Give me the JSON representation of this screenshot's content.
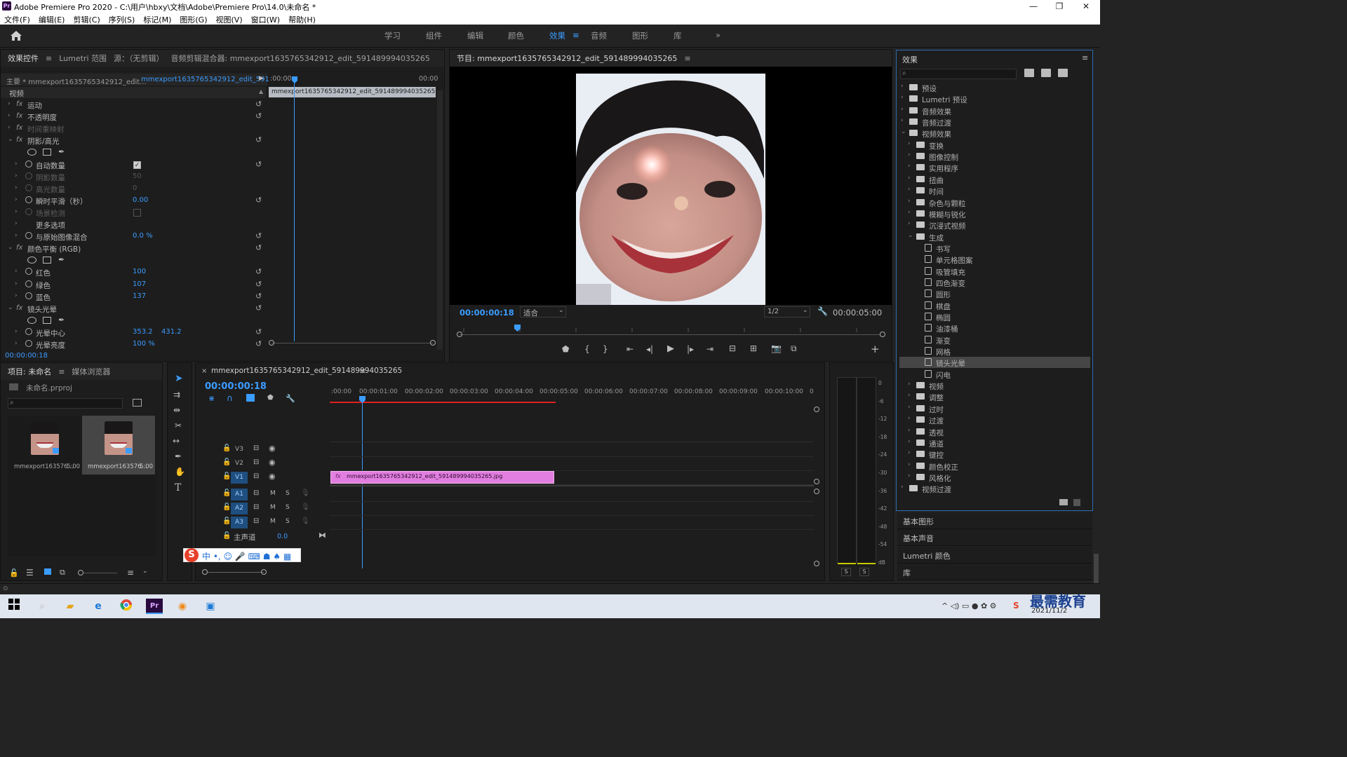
{
  "window": {
    "title": "Adobe Premiere Pro 2020 - C:\\用户\\hbxy\\文档\\Adobe\\Premiere Pro\\14.0\\未命名 *",
    "logo_text": "Pr",
    "minimize": "—",
    "restore": "❐",
    "close": "✕"
  },
  "menu": [
    "文件(F)",
    "编辑(E)",
    "剪辑(C)",
    "序列(S)",
    "标记(M)",
    "图形(G)",
    "视图(V)",
    "窗口(W)",
    "帮助(H)"
  ],
  "workspaces": {
    "items": [
      "学习",
      "组件",
      "编辑",
      "颜色",
      "效果",
      "音频",
      "图形",
      "库"
    ],
    "active": "效果",
    "more": "»"
  },
  "effect_controls": {
    "tabs": [
      "效果控件",
      "Lumetri 范围",
      "源：（无剪辑）",
      "音频剪辑混合器: mmexport1635765342912_edit_591489994035265"
    ],
    "master_label": "主要 * mmexport1635765342912_edit...",
    "clip_label": "mmexport1635765342912_edit_591...",
    "time_start": ":00:00",
    "time_end": "00:00",
    "clip_bar": "mmexport1635765342912_edit_591489994035265.jpg",
    "section_video": "视频",
    "rows": [
      {
        "type": "fx",
        "label": "运动"
      },
      {
        "type": "fx",
        "label": "不透明度"
      },
      {
        "type": "fx-off",
        "label": "时间重映射"
      },
      {
        "type": "fx-open",
        "label": "阴影/高光"
      },
      {
        "type": "masks"
      },
      {
        "type": "param",
        "label": "自动数量",
        "checkbox": true,
        "checked": true
      },
      {
        "type": "param-off",
        "label": "阴影数量",
        "value": "50"
      },
      {
        "type": "param-off",
        "label": "高光数量",
        "value": "0"
      },
      {
        "type": "param",
        "label": "瞬时平滑（秒）",
        "value": "0.00"
      },
      {
        "type": "param-off",
        "label": "场景检测",
        "checkbox": true,
        "checked": false
      },
      {
        "type": "sub",
        "label": "更多选项"
      },
      {
        "type": "param",
        "label": "与原始图像混合",
        "value": "0.0 %"
      },
      {
        "type": "fx-open",
        "label": "颜色平衡 (RGB)"
      },
      {
        "type": "masks"
      },
      {
        "type": "param",
        "label": "红色",
        "value": "100"
      },
      {
        "type": "param",
        "label": "绿色",
        "value": "107"
      },
      {
        "type": "param",
        "label": "蓝色",
        "value": "137"
      },
      {
        "type": "fx-open",
        "label": "镜头光晕"
      },
      {
        "type": "masks"
      },
      {
        "type": "param",
        "label": "光晕中心",
        "value": "353.2",
        "value2": "431.2"
      },
      {
        "type": "param",
        "label": "光晕亮度",
        "value": "100 %"
      }
    ],
    "current_time": "00:00:00:18"
  },
  "program_monitor": {
    "title": "节目: mmexport1635765342912_edit_591489994035265",
    "timecode": "00:00:00:18",
    "fit": "适合",
    "quality": "1/2",
    "duration": "00:00:05:00"
  },
  "effects_panel": {
    "title": "效果",
    "search_placeholder": "",
    "tree": [
      {
        "level": 0,
        "label": "预设",
        "icon": "folder",
        "open": false
      },
      {
        "level": 0,
        "label": "Lumetri 预设",
        "icon": "folder",
        "open": false
      },
      {
        "level": 0,
        "label": "音频效果",
        "icon": "folder",
        "open": false
      },
      {
        "level": 0,
        "label": "音频过渡",
        "icon": "folder",
        "open": false
      },
      {
        "level": 0,
        "label": "视频效果",
        "icon": "folder",
        "open": true
      },
      {
        "level": 1,
        "label": "变换",
        "icon": "folder",
        "open": false
      },
      {
        "level": 1,
        "label": "图像控制",
        "icon": "folder",
        "open": false
      },
      {
        "level": 1,
        "label": "实用程序",
        "icon": "folder",
        "open": false
      },
      {
        "level": 1,
        "label": "扭曲",
        "icon": "folder",
        "open": false
      },
      {
        "level": 1,
        "label": "时间",
        "icon": "folder",
        "open": false
      },
      {
        "level": 1,
        "label": "杂色与颗粒",
        "icon": "folder",
        "open": false
      },
      {
        "level": 1,
        "label": "模糊与锐化",
        "icon": "folder",
        "open": false
      },
      {
        "level": 1,
        "label": "沉浸式视频",
        "icon": "folder",
        "open": false
      },
      {
        "level": 1,
        "label": "生成",
        "icon": "folder",
        "open": true
      },
      {
        "level": 2,
        "label": "书写",
        "icon": "fx"
      },
      {
        "level": 2,
        "label": "单元格图案",
        "icon": "fx"
      },
      {
        "level": 2,
        "label": "吸管填充",
        "icon": "fx"
      },
      {
        "level": 2,
        "label": "四色渐变",
        "icon": "fx"
      },
      {
        "level": 2,
        "label": "圆形",
        "icon": "fx"
      },
      {
        "level": 2,
        "label": "棋盘",
        "icon": "fx"
      },
      {
        "level": 2,
        "label": "椭圆",
        "icon": "fx"
      },
      {
        "level": 2,
        "label": "油漆桶",
        "icon": "fx"
      },
      {
        "level": 2,
        "label": "渐变",
        "icon": "fx"
      },
      {
        "level": 2,
        "label": "网格",
        "icon": "fx"
      },
      {
        "level": 2,
        "label": "镜头光晕",
        "icon": "fx",
        "selected": true
      },
      {
        "level": 2,
        "label": "闪电",
        "icon": "fx"
      },
      {
        "level": 1,
        "label": "视频",
        "icon": "folder",
        "open": false
      },
      {
        "level": 1,
        "label": "调整",
        "icon": "folder",
        "open": false
      },
      {
        "level": 1,
        "label": "过时",
        "icon": "folder",
        "open": false
      },
      {
        "level": 1,
        "label": "过渡",
        "icon": "folder",
        "open": false
      },
      {
        "level": 1,
        "label": "透视",
        "icon": "folder",
        "open": false
      },
      {
        "level": 1,
        "label": "通道",
        "icon": "folder",
        "open": false
      },
      {
        "level": 1,
        "label": "键控",
        "icon": "folder",
        "open": false
      },
      {
        "level": 1,
        "label": "颜色校正",
        "icon": "folder",
        "open": false
      },
      {
        "level": 1,
        "label": "风格化",
        "icon": "folder",
        "open": false
      },
      {
        "level": 0,
        "label": "视频过渡",
        "icon": "folder",
        "open": false
      }
    ]
  },
  "side_panels": [
    "基本图形",
    "基本声音",
    "Lumetri 颜色",
    "库"
  ],
  "project": {
    "tabs": [
      "项目: 未命名",
      "媒体浏览器"
    ],
    "file": "未命名.prproj",
    "items": [
      {
        "name": "mmexport163576...",
        "duration": "5:00",
        "selected": false
      },
      {
        "name": "mmexport163576...",
        "duration": "5:00",
        "selected": true
      }
    ]
  },
  "timeline": {
    "tab": "mmexport1635765342912_edit_591489994035265",
    "timecode": "00:00:00:18",
    "ruler": [
      ":00:00",
      "00:00:01:00",
      "00:00:02:00",
      "00:00:03:00",
      "00:00:04:00",
      "00:00:05:00",
      "00:00:06:00",
      "00:00:07:00",
      "00:00:08:00",
      "00:00:09:00",
      "00:00:10:00",
      "0"
    ],
    "video_tracks": [
      "V3",
      "V2",
      "V1"
    ],
    "audio_tracks": [
      "A1",
      "A2",
      "A3"
    ],
    "master_label": "主声道",
    "master_value": "0.0",
    "clip_label": "mmexport1635765342912_edit_591489994035265.jpg",
    "m_label": "M",
    "s_label": "S"
  },
  "audio_meter": {
    "scale": [
      "0",
      "-6",
      "-12",
      "-18",
      "-24",
      "-30",
      "-36",
      "-42",
      "-48",
      "-54",
      "dB"
    ],
    "solo": [
      "S",
      "S"
    ]
  },
  "taskbar": {
    "time": "",
    "date": "2021/11/2",
    "watermark": "最需教育"
  },
  "colors": {
    "accent": "#3b9cff",
    "clip": "#e27ee0",
    "selection": "#464646"
  }
}
